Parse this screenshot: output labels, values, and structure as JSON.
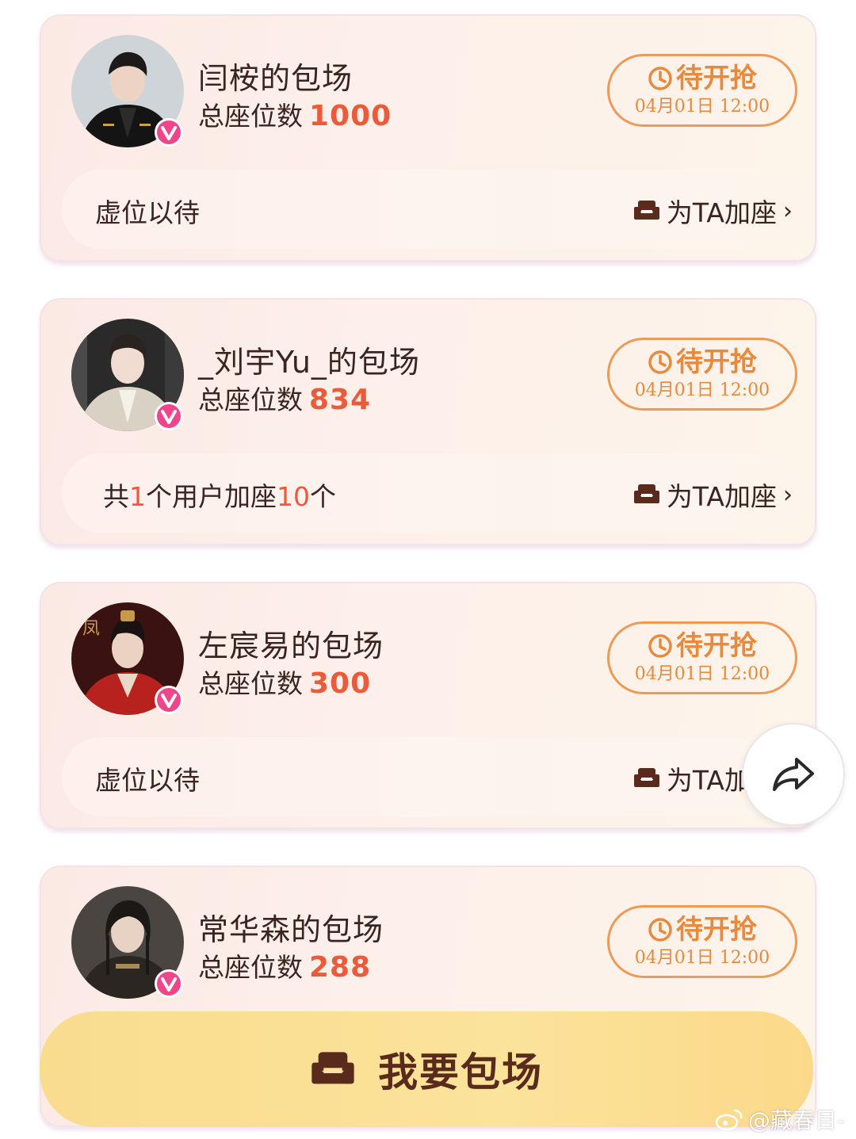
{
  "cards": [
    {
      "title": "闫桉的包场",
      "seats_label": "总座位数",
      "seats_value": "1000",
      "status_label": "待开抢",
      "status_time": "04月01日 12:00",
      "strip_text": "虚位以待",
      "add_label": "为TA加座",
      "avatar_bg": "#cfd4d8",
      "avatar_cloth": "#141414"
    },
    {
      "title": "_刘宇Yu_的包场",
      "seats_label": "总座位数",
      "seats_value": "834",
      "status_label": "待开抢",
      "status_time": "04月01日 12:00",
      "strip_prefix": "共",
      "strip_users": "1",
      "strip_mid": "个用户加座",
      "strip_count": "10",
      "strip_suffix": "个",
      "add_label": "为TA加座",
      "avatar_bg": "#2a2a2a",
      "avatar_cloth": "#d9d2c4"
    },
    {
      "title": "左宸易的包场",
      "seats_label": "总座位数",
      "seats_value": "300",
      "status_label": "待开抢",
      "status_time": "04月01日 12:00",
      "strip_text": "虚位以待",
      "add_label": "为TA加座",
      "avatar_bg": "#3a1212",
      "avatar_cloth": "#b8221e"
    },
    {
      "title": "常华森的包场",
      "seats_label": "总座位数",
      "seats_value": "288",
      "status_label": "待开抢",
      "status_time": "04月01日 12:00",
      "avatar_bg": "#4a4540",
      "avatar_cloth": "#2c2622"
    }
  ],
  "cta": {
    "label": "我要包场"
  },
  "watermark": {
    "text": "@藏春目-"
  },
  "colors": {
    "accent_orange": "#e8893c",
    "number_red": "#ec5a3a",
    "badge_pink": "#f0458a",
    "text_dark": "#3a2420"
  },
  "icons": [
    "avatar",
    "verified-v-badge-icon",
    "clock-icon",
    "sofa-icon",
    "chevron-right-icon",
    "share-arrow-icon",
    "weibo-logo-icon"
  ]
}
